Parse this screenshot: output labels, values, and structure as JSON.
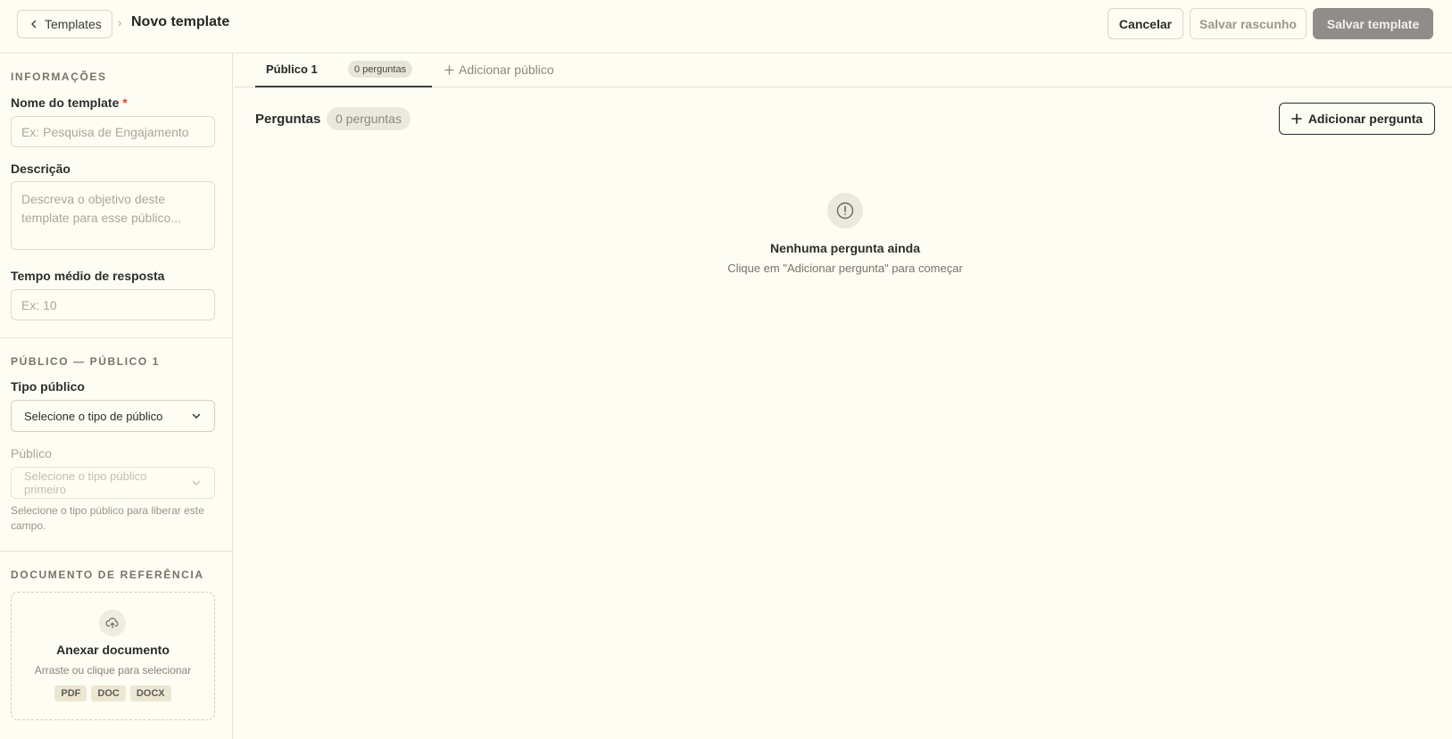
{
  "header": {
    "back_label": "Templates",
    "separator": "›",
    "title": "Novo template",
    "cancel_label": "Cancelar",
    "draft_label": "Salvar rascunho",
    "save_label": "Salvar template"
  },
  "sidebar": {
    "info_section": "INFORMAÇÕES",
    "name_label": "Nome do template",
    "name_required": "*",
    "name_placeholder": "Ex: Pesquisa de Engajamento",
    "description_label": "Descrição",
    "description_placeholder": "Descreva o objetivo deste template para esse público...",
    "time_label": "Tempo médio de resposta",
    "time_placeholder": "Ex: 10",
    "audience_section": "PÚBLICO — PÚBLICO 1",
    "audience_type_label": "Tipo público",
    "audience_type_value": "Selecione o tipo de público",
    "audience_label": "Público",
    "audience_value": "Selecione o tipo público primeiro",
    "audience_hint": "Selecione o tipo público para liberar este campo.",
    "doc_section": "DOCUMENTO DE REFERÊNCIA",
    "doc_title": "Anexar documento",
    "doc_sub": "Arraste ou clique para selecionar",
    "doc_types": [
      "PDF",
      "DOC",
      "DOCX"
    ]
  },
  "tabs": {
    "active_label": "Público 1",
    "active_badge": "0 perguntas",
    "add_label": "Adicionar público"
  },
  "questions": {
    "title": "Perguntas",
    "count": "0 perguntas",
    "add_label": "Adicionar pergunta",
    "empty_title": "Nenhuma pergunta ainda",
    "empty_sub": "Clique em \"Adicionar pergunta\" para começar"
  },
  "colors": {
    "background": "#fefdf3",
    "primary_disabled": "#8f8c8a",
    "required": "#d84a3a"
  }
}
